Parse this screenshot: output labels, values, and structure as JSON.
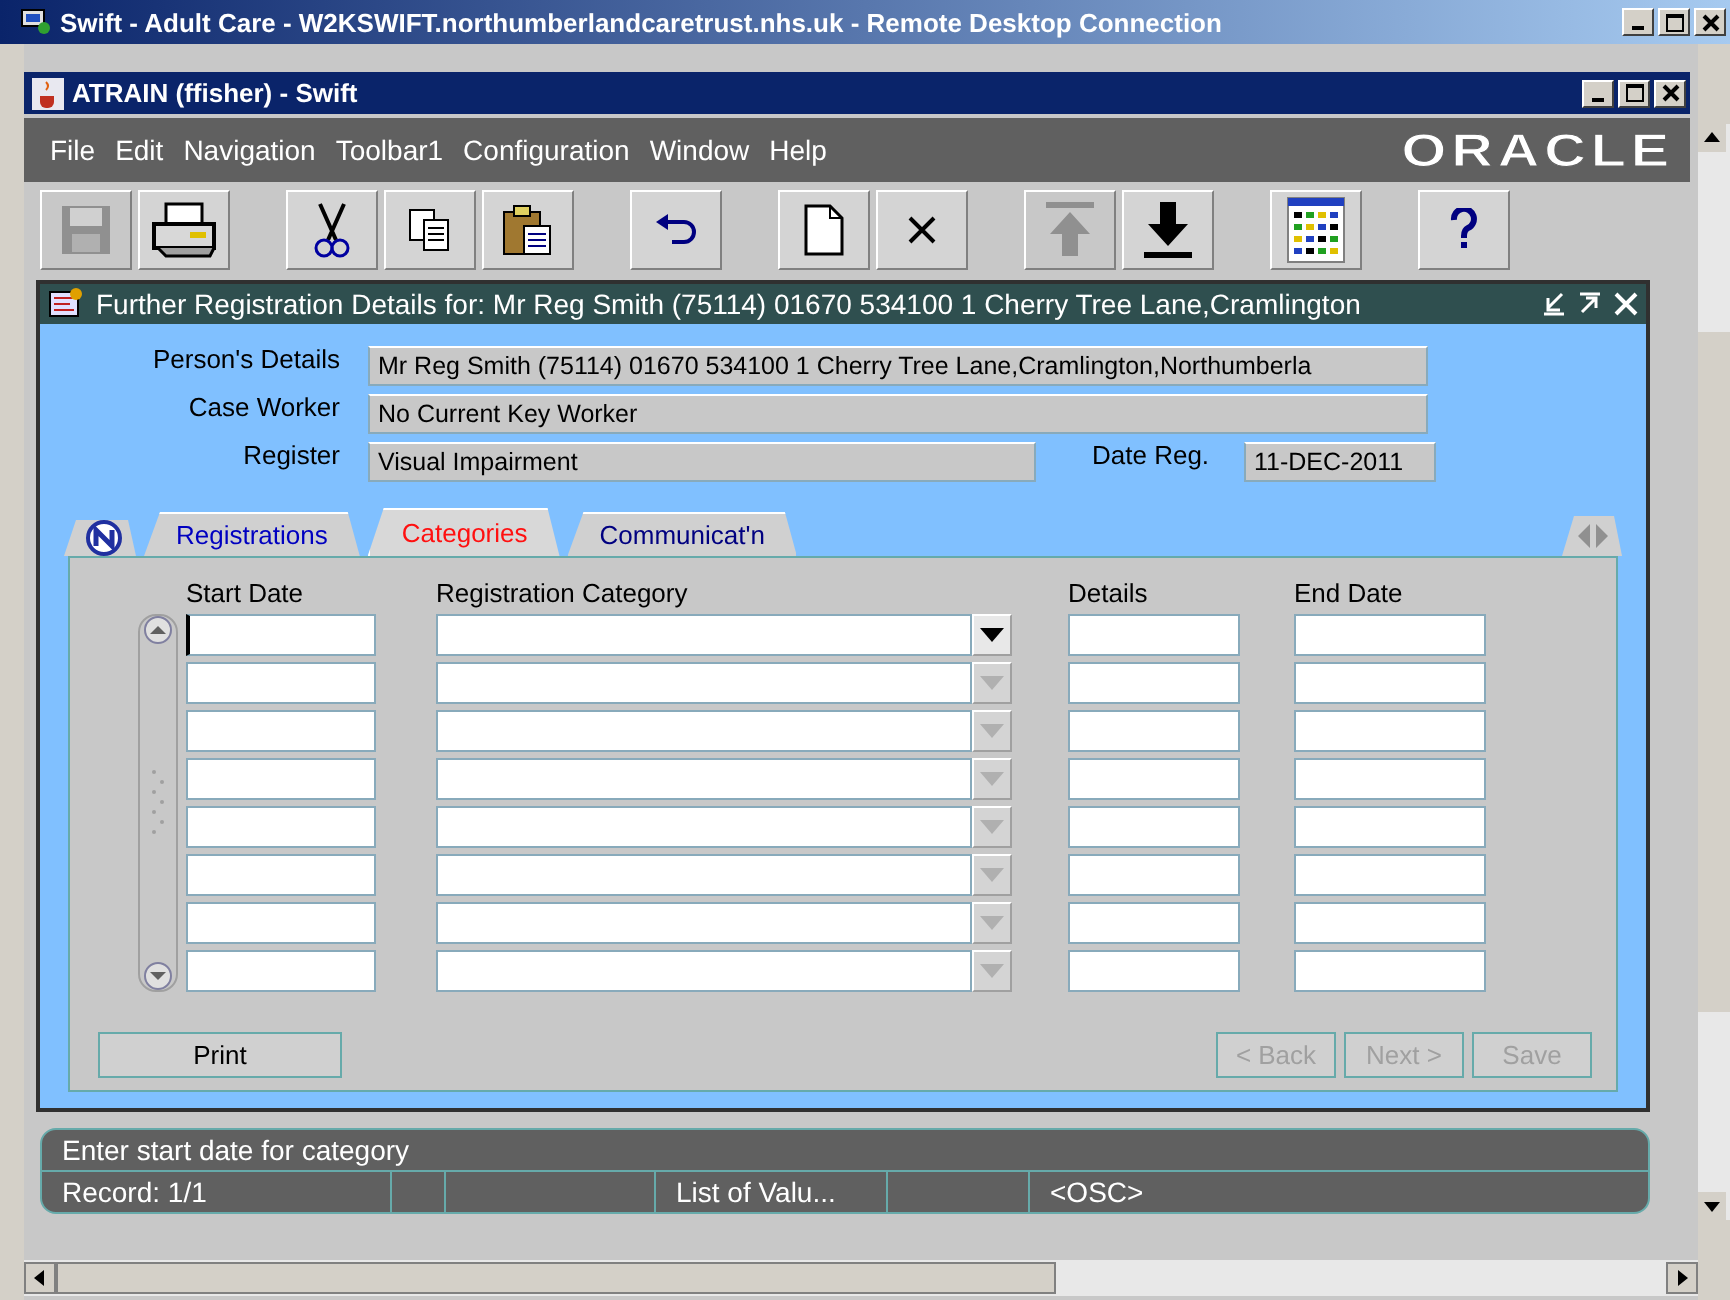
{
  "rdp_window": {
    "title": "Swift - Adult Care - W2KSWIFT.northumberlandcaretrust.nhs.uk - Remote Desktop Connection"
  },
  "app_window": {
    "title": "ATRAIN (ffisher) - Swift"
  },
  "menu": [
    "File",
    "Edit",
    "Navigation",
    "Toolbar1",
    "Configuration",
    "Window",
    "Help"
  ],
  "logo": "ORACLE",
  "toolbar": [
    {
      "kind": "save",
      "disabled": true
    },
    {
      "kind": "print",
      "disabled": false
    },
    {
      "kind": "cut",
      "disabled": false
    },
    {
      "kind": "copy",
      "disabled": false
    },
    {
      "kind": "paste",
      "disabled": false
    },
    {
      "kind": "undo",
      "disabled": false
    },
    {
      "kind": "new",
      "disabled": false
    },
    {
      "kind": "delete",
      "disabled": false
    },
    {
      "kind": "up",
      "disabled": true
    },
    {
      "kind": "down",
      "disabled": false
    },
    {
      "kind": "grid",
      "disabled": false
    },
    {
      "kind": "help",
      "disabled": false
    }
  ],
  "form": {
    "title": "Further Registration Details for:  Mr Reg Smith (75114) 01670 534100 1 Cherry Tree Lane,Cramlington",
    "persons_details": {
      "label": "Person's Details",
      "value": "Mr Reg Smith (75114) 01670 534100 1 Cherry Tree Lane,Cramlington,Northumberla"
    },
    "case_worker": {
      "label": "Case Worker",
      "value": "No Current Key Worker"
    },
    "register": {
      "label": "Register",
      "value": "Visual Impairment"
    },
    "date_reg": {
      "label": "Date Reg.",
      "value": "11-DEC-2011"
    },
    "tabs": [
      {
        "label": "Registrations",
        "selected": false
      },
      {
        "label": "Categories",
        "selected": true
      },
      {
        "label": "Communicat'n",
        "selected": false
      }
    ],
    "columns": [
      "Start Date",
      "Registration Category",
      "Details",
      "End Date"
    ],
    "rows": [
      {
        "current": true
      },
      {
        "current": false
      },
      {
        "current": false
      },
      {
        "current": false
      },
      {
        "current": false
      },
      {
        "current": false
      },
      {
        "current": false
      },
      {
        "current": false
      }
    ],
    "buttons": [
      {
        "label": "Print",
        "disabled": false
      },
      {
        "label": "< Back",
        "disabled": true
      },
      {
        "label": "Next >",
        "disabled": true
      },
      {
        "label": "Save",
        "disabled": true
      }
    ]
  },
  "status_bar": {
    "message": "Enter start date for category",
    "record": "Record: 1/1",
    "lov": "List of Valu...",
    "osc": "<OSC>"
  }
}
